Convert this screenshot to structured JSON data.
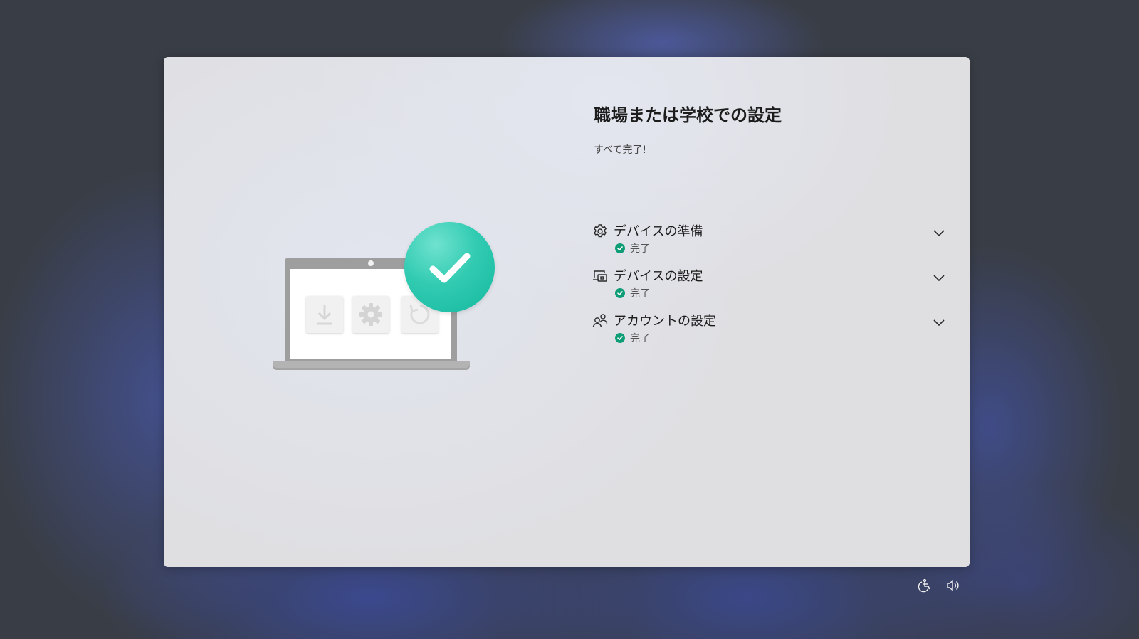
{
  "window": {
    "title": "職場または学校での設定",
    "subtitle": "すべて完了!"
  },
  "steps": [
    {
      "label": "デバイスの準備",
      "status": "完了",
      "icon": "gear-icon"
    },
    {
      "label": "デバイスの設定",
      "status": "完了",
      "icon": "device-setup-icon"
    },
    {
      "label": "アカウントの設定",
      "status": "完了",
      "icon": "people-icon"
    }
  ],
  "illustration": {
    "tiles": [
      "download-icon",
      "gear-icon",
      "refresh-icon"
    ],
    "badge": "checkmark-icon"
  },
  "system": {
    "accessibility_icon": "accessibility-icon",
    "volume_icon": "volume-icon"
  },
  "colors": {
    "success": "#0f9d77",
    "badge": "#2fc7ad",
    "panel": "#dfdfe2"
  }
}
